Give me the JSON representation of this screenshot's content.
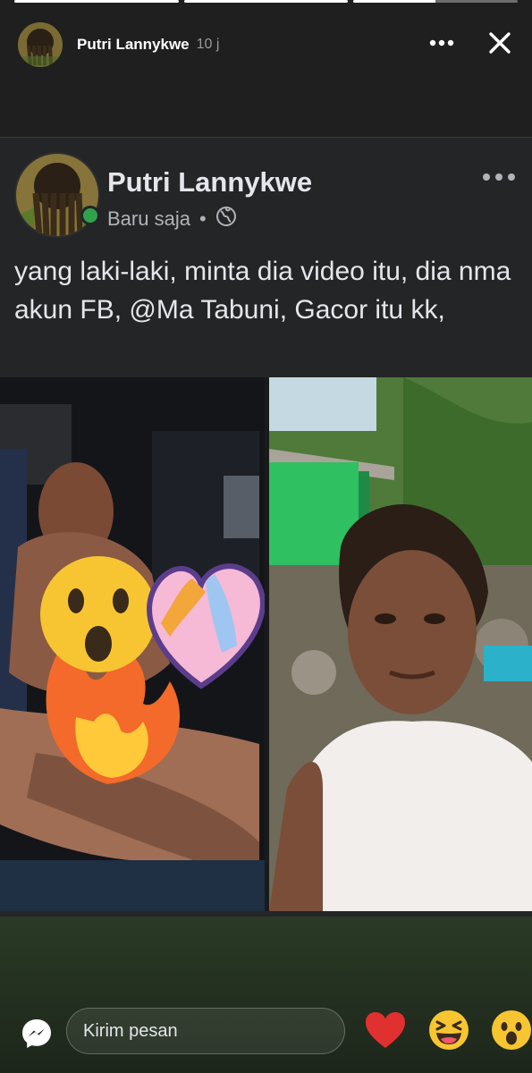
{
  "story": {
    "progress": [
      1,
      1,
      0.5
    ],
    "author": "Putri Lannykwe",
    "time": "10 j"
  },
  "post": {
    "author": "Putri Lannykwe",
    "meta_time": "Baru saja",
    "meta_separator": "•",
    "audience_icon": "globe-icon",
    "text": "yang laki-laki, minta dia video itu, dia nma akun FB, @Ma Tabuni, Gacor itu kk,",
    "stickers": [
      "wow-emoji-sticker",
      "fire-sticker",
      "heart-paws-sticker"
    ]
  },
  "reply": {
    "placeholder": "Kirim pesan"
  },
  "reactions": [
    "heart",
    "laughing",
    "wow"
  ],
  "colors": {
    "online": "#31a24c",
    "heart": "#e0302f",
    "reaction_yellow": "#f7c531"
  }
}
